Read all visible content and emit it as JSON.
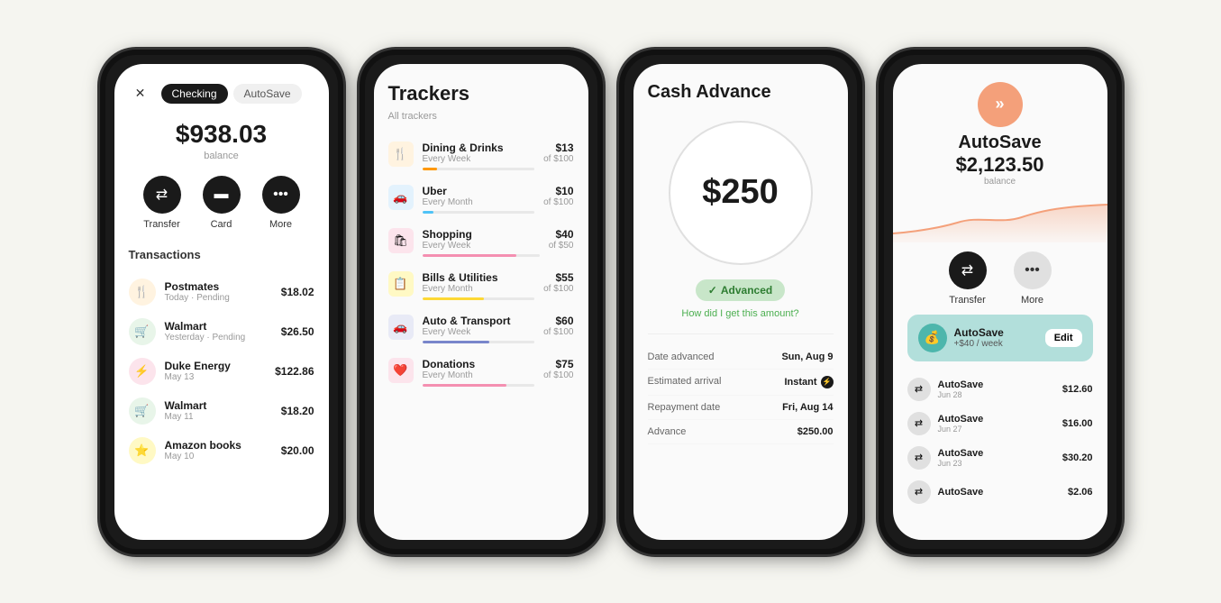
{
  "phone1": {
    "tabs": [
      "Checking",
      "AutoSave"
    ],
    "active_tab": "Checking",
    "balance": "$938.03",
    "balance_label": "balance",
    "actions": [
      {
        "label": "Transfer",
        "icon": "⇄"
      },
      {
        "label": "Card",
        "icon": "▬"
      },
      {
        "label": "More",
        "icon": "•••"
      }
    ],
    "transactions_title": "Transactions",
    "transactions": [
      {
        "name": "Postmates",
        "date": "Today · Pending",
        "amount": "$18.02",
        "icon": "🍴",
        "color": "food"
      },
      {
        "name": "Walmart",
        "date": "Yesterday · Pending",
        "amount": "$26.50",
        "icon": "🛒",
        "color": "shopping"
      },
      {
        "name": "Duke Energy",
        "date": "May 13",
        "amount": "$122.86",
        "icon": "⚡",
        "color": "utility"
      },
      {
        "name": "Walmart",
        "date": "May 11",
        "amount": "$18.20",
        "icon": "🛒",
        "color": "shopping"
      },
      {
        "name": "Amazon books",
        "date": "May 10",
        "amount": "$20.00",
        "icon": "⭐",
        "color": "books"
      }
    ]
  },
  "phone2": {
    "title": "Trackers",
    "subtitle": "All trackers",
    "trackers": [
      {
        "name": "Dining & Drinks",
        "freq": "Every Week",
        "spent": "$13",
        "total": "of $100",
        "pct": 13,
        "color": "#ff9800",
        "icon": "🍴",
        "icon_color": "dining"
      },
      {
        "name": "Uber",
        "freq": "Every Month",
        "spent": "$10",
        "total": "of $100",
        "pct": 10,
        "color": "#4fc3f7",
        "icon": "🚗",
        "icon_color": "transport"
      },
      {
        "name": "Shopping",
        "freq": "Every Week",
        "spent": "$40",
        "total": "of $50",
        "pct": 80,
        "color": "#f48fb1",
        "icon": "🛍",
        "icon_color": "shopping"
      },
      {
        "name": "Bills & Utilities",
        "freq": "Every Month",
        "spent": "$55",
        "total": "of $100",
        "pct": 55,
        "color": "#fff176",
        "icon": "📋",
        "icon_color": "bills"
      },
      {
        "name": "Auto & Transport",
        "freq": "Every Week",
        "spent": "$60",
        "total": "of $100",
        "pct": 60,
        "color": "#9fa8da",
        "icon": "🚗",
        "icon_color": "auto"
      },
      {
        "name": "Donations",
        "freq": "Every Month",
        "spent": "$75",
        "total": "of $100",
        "pct": 75,
        "color": "#f48fb1",
        "icon": "❤️",
        "icon_color": "donations"
      }
    ]
  },
  "phone3": {
    "title": "Cash Advance",
    "amount": "$250",
    "badge": "Advanced",
    "how_link": "How did I get this amount?",
    "details": [
      {
        "label": "Date advanced",
        "value": "Sun, Aug 9",
        "has_badge": false
      },
      {
        "label": "Estimated arrival",
        "value": "Instant",
        "has_badge": true
      },
      {
        "label": "Repayment date",
        "value": "Fri, Aug 14",
        "has_badge": false
      },
      {
        "label": "Advance",
        "value": "$250.00",
        "has_badge": false
      }
    ]
  },
  "phone4": {
    "logo": "»",
    "title": "AutoSave",
    "balance": "$2,123.50",
    "balance_label": "balance",
    "actions": [
      {
        "label": "Transfer",
        "icon": "⇄"
      },
      {
        "label": "More",
        "icon": "•••"
      }
    ],
    "rule": {
      "name": "AutoSave",
      "amount": "+$40 / week",
      "edit": "Edit"
    },
    "transactions": [
      {
        "name": "AutoSave",
        "date": "Jun 28",
        "amount": "$12.60"
      },
      {
        "name": "AutoSave",
        "date": "Jun 27",
        "amount": "$16.00"
      },
      {
        "name": "AutoSave",
        "date": "Jun 23",
        "amount": "$30.20"
      },
      {
        "name": "AutoSave",
        "date": "",
        "amount": "$2.06"
      }
    ]
  }
}
